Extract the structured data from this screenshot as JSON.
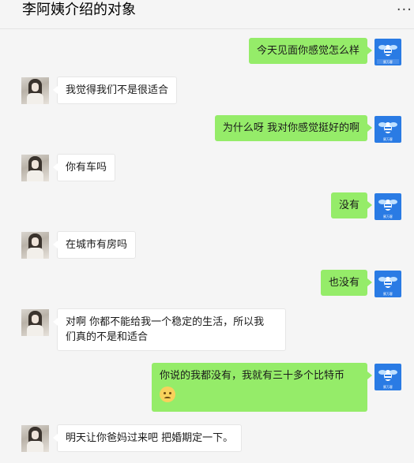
{
  "header": {
    "title": "李阿姨介绍的对象",
    "more_label": "···"
  },
  "contact_avatar_icon": "person-photo",
  "self_avatar_icon": "bee-logo",
  "self_avatar_caption": "蜜万客",
  "messages": [
    {
      "sender": "self",
      "text": "今天见面你感觉怎么样"
    },
    {
      "sender": "contact",
      "text": "我觉得我们不是很适合"
    },
    {
      "sender": "self",
      "text": "为什么呀 我对你感觉挺好的啊"
    },
    {
      "sender": "contact",
      "text": "你有车吗"
    },
    {
      "sender": "self",
      "text": "没有"
    },
    {
      "sender": "contact",
      "text": "在城市有房吗"
    },
    {
      "sender": "self",
      "text": "也没有"
    },
    {
      "sender": "contact",
      "line1": "对啊 你都不能给我一个稳定的生活，所以我",
      "line2": "们真的不是和适合"
    },
    {
      "sender": "self",
      "text": "你说的我都没有，我就有三十多个比特币",
      "emoji": "sad-face-emoji"
    },
    {
      "sender": "contact",
      "text": "明天让你爸妈过来吧 把婚期定一下。"
    }
  ],
  "colors": {
    "self_bubble": "#95ec69",
    "contact_bubble": "#ffffff",
    "background": "#f5f5f5",
    "self_avatar": "#2a7be4"
  }
}
